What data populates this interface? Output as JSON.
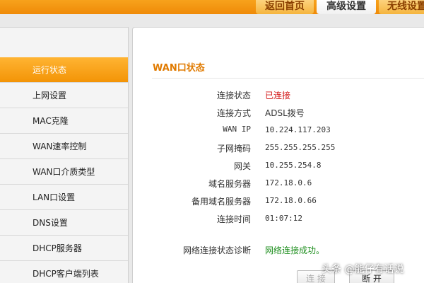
{
  "tabs": {
    "home": "返回首页",
    "advanced": "高级设置",
    "wireless": "无线设置"
  },
  "sidebar": {
    "items": [
      {
        "label": "运行状态",
        "active": true
      },
      {
        "label": "上网设置"
      },
      {
        "label": "MAC克隆"
      },
      {
        "label": "WAN速率控制"
      },
      {
        "label": "WAN口介质类型"
      },
      {
        "label": "LAN口设置"
      },
      {
        "label": "DNS设置"
      },
      {
        "label": "DHCP服务器"
      },
      {
        "label": "DHCP客户端列表"
      }
    ]
  },
  "wan": {
    "title": "WAN口状态",
    "rows": [
      {
        "label": "连接状态",
        "value": "已连接"
      },
      {
        "label": "连接方式",
        "value": "ADSL拨号"
      },
      {
        "label": "WAN IP",
        "value": "10.224.117.203"
      },
      {
        "label": "子网掩码",
        "value": "255.255.255.255"
      },
      {
        "label": "网关",
        "value": "10.255.254.8"
      },
      {
        "label": "域名服务器",
        "value": "172.18.0.6"
      },
      {
        "label": "备用域名服务器",
        "value": "172.18.0.66"
      },
      {
        "label": "连接时间",
        "value": "01:07:12"
      }
    ],
    "diag_label": "网络连接状态诊断",
    "diag_value": "网络连接成功。"
  },
  "buttons": {
    "connect": "连 接",
    "disconnect": "断 开"
  },
  "watermark": "头条 @能仔有话说",
  "colors": {
    "accent_orange": "#f39406",
    "status_red": "#d31a1a",
    "status_green": "#1f8f1f"
  }
}
